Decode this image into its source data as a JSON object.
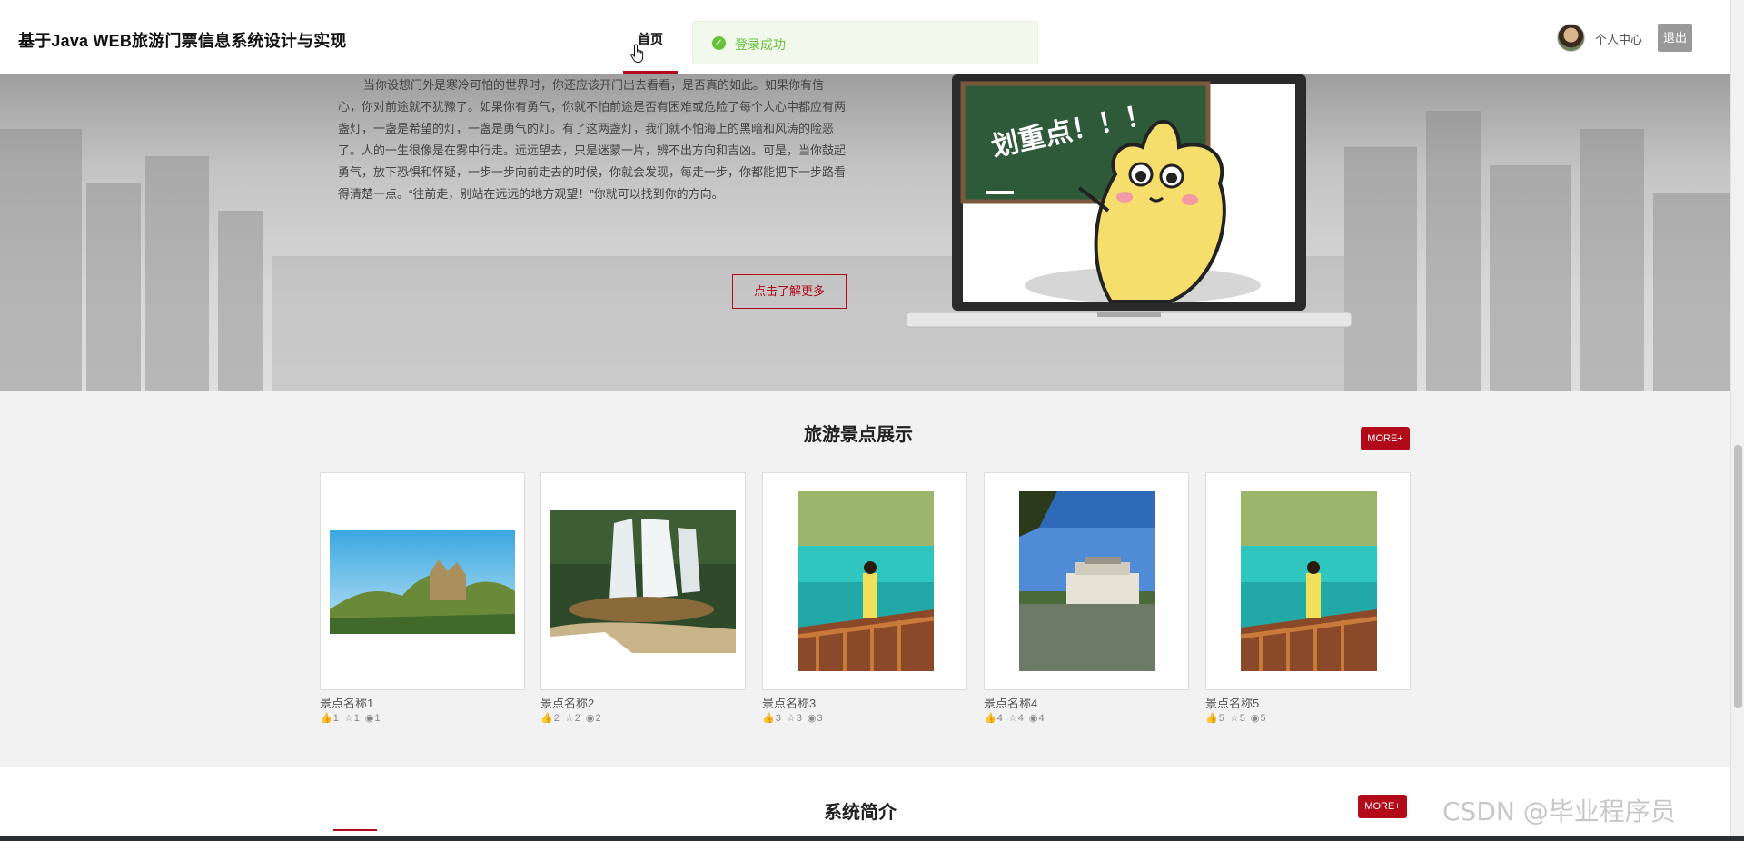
{
  "header": {
    "site_title": "基于Java WEB旅游门票信息系统设计与实现",
    "nav_home": "首页",
    "profile_label": "个人中心",
    "logout_label": "退出"
  },
  "toast": {
    "message": "登录成功",
    "status_color": "#67c23a"
  },
  "hero": {
    "paragraph": "当你设想门外是寒冷可怕的世界时，你还应该开门出去看看，是否真的如此。如果你有信心，你对前途就不犹豫了。如果你有勇气，你就不怕前途是否有困难或危险了每个人心中都应有两盏灯，一盏是希望的灯，一盏是勇气的灯。有了这两盏灯，我们就不怕海上的黑暗和风涛的险恶了。人的一生很像是在雾中行走。远远望去，只是迷蒙一片，辨不出方向和吉凶。可是，当你鼓起勇气，放下恐惧和怀疑，一步一步向前走去的时候，你就会发现，每走一步，你都能把下一步路看得清楚一点。“往前走，别站在远远的地方观望！”你就可以找到你的方向。",
    "learn_more": "点击了解更多",
    "blackboard_text": "划重点！！！"
  },
  "attractions": {
    "title": "旅游景点展示",
    "more_label": "MORE+",
    "items": [
      {
        "name": "景点名称1",
        "likes": "1",
        "favorites": "1",
        "views": "1"
      },
      {
        "name": "景点名称2",
        "likes": "2",
        "favorites": "2",
        "views": "2"
      },
      {
        "name": "景点名称3",
        "likes": "3",
        "favorites": "3",
        "views": "3"
      },
      {
        "name": "景点名称4",
        "likes": "4",
        "favorites": "4",
        "views": "4"
      },
      {
        "name": "景点名称5",
        "likes": "5",
        "favorites": "5",
        "views": "5"
      }
    ]
  },
  "intro": {
    "title": "系统简介",
    "more_label": "MORE+"
  },
  "watermark": "CSDN @毕业程序员",
  "colors": {
    "accent": "#b30a1a",
    "success": "#67c23a"
  }
}
